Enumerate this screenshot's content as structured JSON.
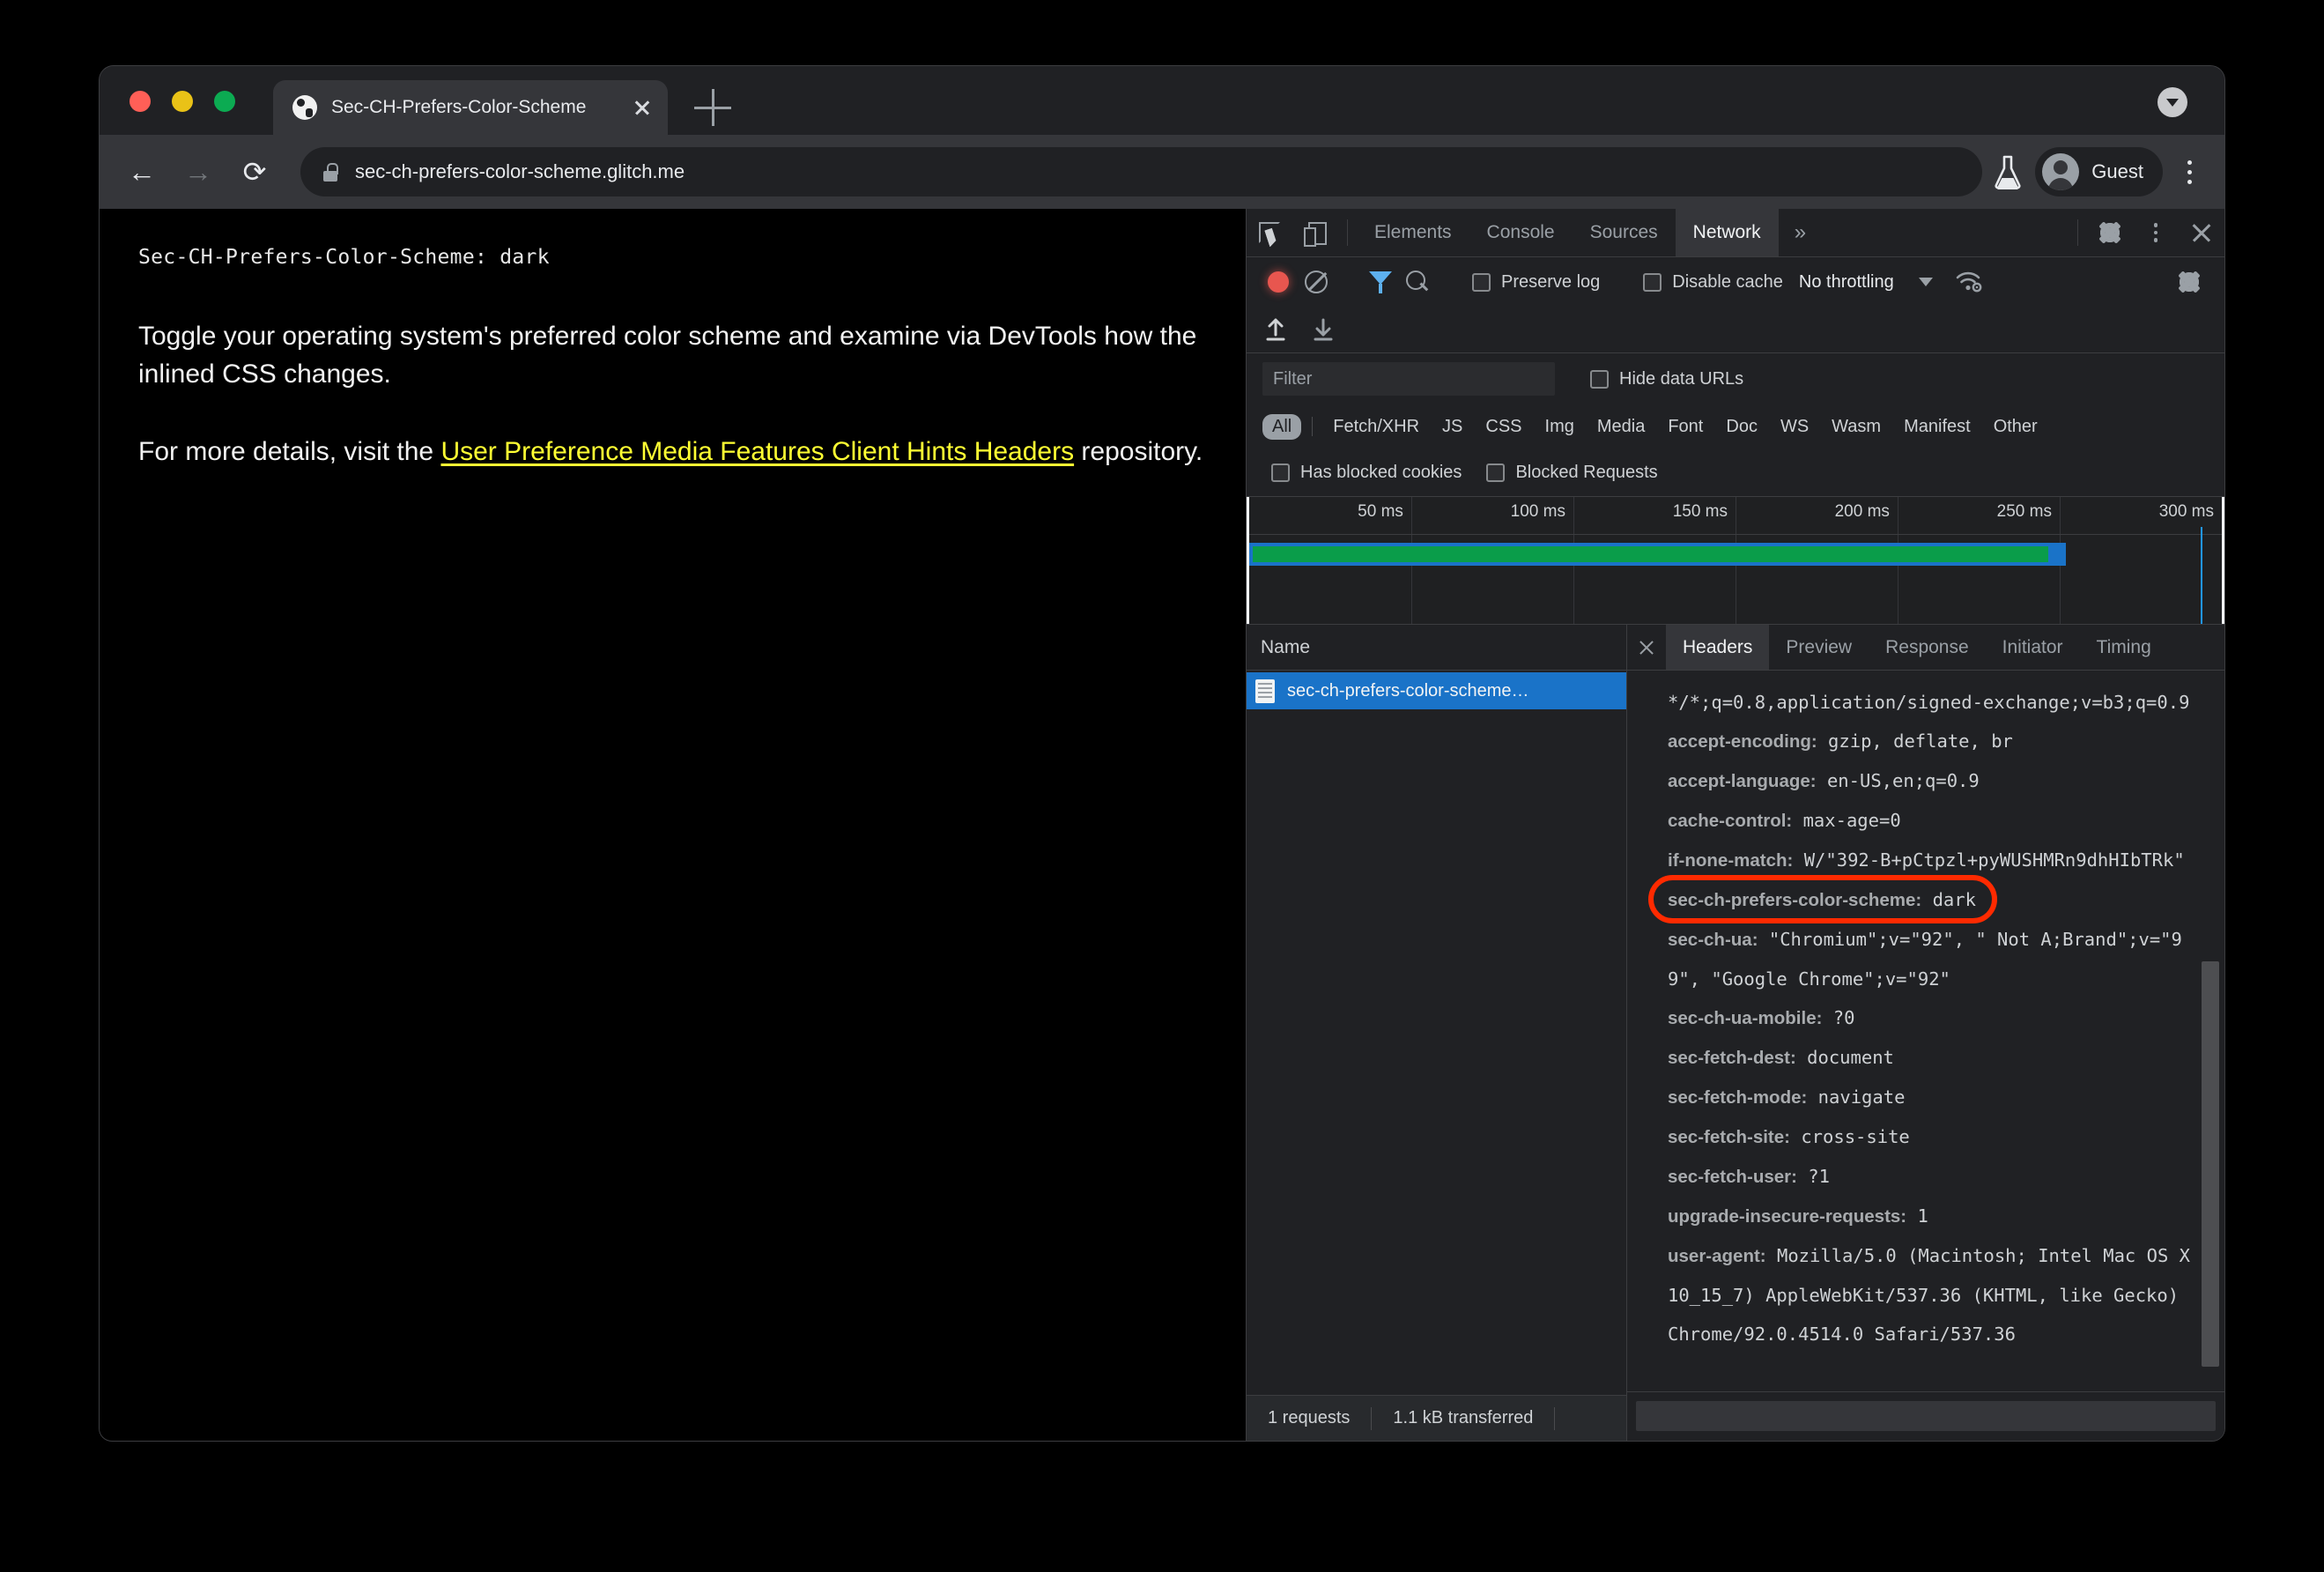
{
  "browser": {
    "tab": {
      "title": "Sec-CH-Prefers-Color-Scheme",
      "favicon": "globe-icon",
      "close": "x"
    },
    "new_tab": "+",
    "nav": {
      "back": "←",
      "forward": "→",
      "reload": "⟳"
    },
    "omnibox": {
      "url": "sec-ch-prefers-color-scheme.glitch.me",
      "lock": "lock-icon"
    },
    "profile": {
      "label": "Guest"
    },
    "flask": "flask-icon",
    "menu": "kebab-icon"
  },
  "page": {
    "header_line": "Sec-CH-Prefers-Color-Scheme: dark",
    "para1": "Toggle your operating system's preferred color scheme and examine via DevTools how the inlined CSS changes.",
    "para2_before": "For more details, visit the ",
    "link_text": "User Preference Media Features Client Hints Headers",
    "para2_after": " repository.",
    "link_color": "#ffff33"
  },
  "devtools": {
    "main_tabs": [
      {
        "label": "Elements",
        "active": false
      },
      {
        "label": "Console",
        "active": false
      },
      {
        "label": "Sources",
        "active": false
      },
      {
        "label": "Network",
        "active": true
      }
    ],
    "more_tabs": "»",
    "icons": {
      "inspect": "inspect-element-icon",
      "device": "device-toolbar-icon",
      "settings": "gear-icon",
      "kebab": "kebab-icon",
      "close": "close-icon"
    },
    "network_toolbar": {
      "record": "record-icon",
      "clear": "clear-icon",
      "filter": "filter-funnel-icon",
      "search": "search-icon",
      "preserve_log": "Preserve log",
      "disable_cache": "Disable cache",
      "throttling": "No throttling",
      "throttle_caret": "chevron-down-icon",
      "network_conditions": "wifi-gear-icon",
      "capture_settings": "gear-icon",
      "import": "import-har-icon",
      "export": "export-har-icon"
    },
    "filter_bar": {
      "placeholder": "Filter",
      "value": "",
      "hide_data_urls": "Hide data URLs"
    },
    "resource_types": [
      {
        "label": "All",
        "active": true
      },
      {
        "label": "Fetch/XHR",
        "active": false
      },
      {
        "label": "JS",
        "active": false
      },
      {
        "label": "CSS",
        "active": false
      },
      {
        "label": "Img",
        "active": false
      },
      {
        "label": "Media",
        "active": false
      },
      {
        "label": "Font",
        "active": false
      },
      {
        "label": "Doc",
        "active": false
      },
      {
        "label": "WS",
        "active": false
      },
      {
        "label": "Wasm",
        "active": false
      },
      {
        "label": "Manifest",
        "active": false
      },
      {
        "label": "Other",
        "active": false
      }
    ],
    "blocked_filters": [
      {
        "label": "Has blocked cookies"
      },
      {
        "label": "Blocked Requests"
      }
    ],
    "overview": {
      "ticks": [
        "50 ms",
        "100 ms",
        "150 ms",
        "200 ms",
        "250 ms",
        "300 ms"
      ],
      "bar_outer_color": "#1a73c8",
      "bar_inner_color": "#0a9d4a"
    },
    "request_list": {
      "column_header": "Name",
      "rows": [
        {
          "name": "sec-ch-prefers-color-scheme…",
          "icon": "document-icon",
          "selected": true
        }
      ]
    },
    "status_bar": {
      "requests": "1 requests",
      "transferred": "1.1 kB transferred"
    },
    "detail_tabs": [
      {
        "label": "Headers",
        "active": true
      },
      {
        "label": "Preview",
        "active": false
      },
      {
        "label": "Response",
        "active": false
      },
      {
        "label": "Initiator",
        "active": false
      },
      {
        "label": "Timing",
        "active": false
      }
    ],
    "headers": [
      {
        "name": "",
        "value": "*/*;q=0.8,application/signed-exchange;v=b3;q=0.9",
        "highlighted": false
      },
      {
        "name": "accept-encoding:",
        "value": " gzip, deflate, br",
        "highlighted": false
      },
      {
        "name": "accept-language:",
        "value": " en-US,en;q=0.9",
        "highlighted": false
      },
      {
        "name": "cache-control:",
        "value": " max-age=0",
        "highlighted": false
      },
      {
        "name": "if-none-match:",
        "value": " W/\"392-B+pCtpzl+pyWUSHMRn9dhHIbTRk\"",
        "highlighted": false
      },
      {
        "name": "sec-ch-prefers-color-scheme:",
        "value": " dark",
        "highlighted": true
      },
      {
        "name": "sec-ch-ua:",
        "value": " \"Chromium\";v=\"92\", \" Not A;Brand\";v=\"99\", \"Google Chrome\";v=\"92\"",
        "highlighted": false
      },
      {
        "name": "sec-ch-ua-mobile:",
        "value": " ?0",
        "highlighted": false
      },
      {
        "name": "sec-fetch-dest:",
        "value": " document",
        "highlighted": false
      },
      {
        "name": "sec-fetch-mode:",
        "value": " navigate",
        "highlighted": false
      },
      {
        "name": "sec-fetch-site:",
        "value": " cross-site",
        "highlighted": false
      },
      {
        "name": "sec-fetch-user:",
        "value": " ?1",
        "highlighted": false
      },
      {
        "name": "upgrade-insecure-requests:",
        "value": " 1",
        "highlighted": false
      },
      {
        "name": "user-agent:",
        "value": " Mozilla/5.0 (Macintosh; Intel Mac OS X 10_15_7) AppleWebKit/537.36 (KHTML, like Gecko) Chrome/92.0.4514.0 Safari/537.36",
        "highlighted": false
      }
    ],
    "annotation": {
      "shape": "oval",
      "color": "#ff2a00",
      "target": "sec-ch-prefers-color-scheme: dark"
    }
  }
}
